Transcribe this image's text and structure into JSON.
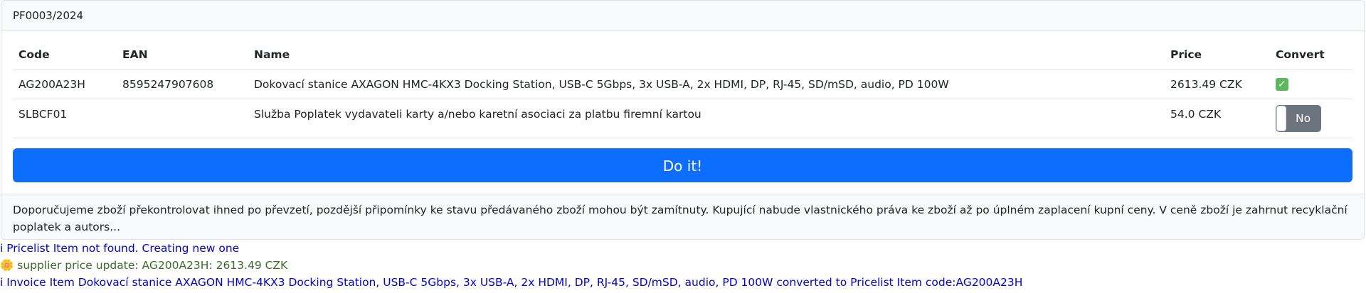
{
  "header": {
    "title": "PF0003/2024"
  },
  "table": {
    "columns": {
      "code": "Code",
      "ean": "EAN",
      "name": "Name",
      "price": "Price",
      "convert": "Convert"
    },
    "rows": [
      {
        "code": "AG200A23H",
        "ean": "8595247907608",
        "name": "Dokovací stanice AXAGON HMC-4KX3 Docking Station, USB-C 5Gbps, 3x USB-A, 2x HDMI, DP, RJ-45, SD/mSD, audio, PD 100W",
        "price": "2613.49 CZK",
        "convert_icon": "check-icon",
        "convert_glyph": "✓"
      },
      {
        "code": "SLBCF01",
        "ean": "",
        "name": "Služba Poplatek vydavateli karty a/nebo karetní asociaci za platbu firemní kartou",
        "price": "54.0 CZK",
        "convert_toggle": "No"
      }
    ]
  },
  "action": {
    "label": "Do it!"
  },
  "footer": {
    "text": "Doporučujeme zboží překontrolovat ihned po převzetí, pozdější připomínky ke stavu předávaného zboží mohou být zamítnuty. Kupující nabude vlastnického práva ke zboží až po úplném zaplacení kupní ceny. V ceně zboží je zahrnut recyklační poplatek a autors..."
  },
  "log": {
    "line1": "i Pricelist Item not found. Creating new one",
    "line2_icon": "sun-icon",
    "line2_glyph": "🌼",
    "line2": " supplier price update: AG200A23H: 2613.49 CZK",
    "line3": "i Invoice Item Dokovací stanice AXAGON HMC-4KX3 Docking Station, USB-C 5Gbps, 3x USB-A, 2x HDMI, DP, RJ-45, SD/mSD, audio, PD 100W converted to Pricelist Item code:AG200A23H"
  },
  "colors": {
    "primary": "#0d6efd",
    "toggle_off": "#6c757d",
    "info_text": "#0000ee",
    "success_text": "#3d6b27"
  }
}
